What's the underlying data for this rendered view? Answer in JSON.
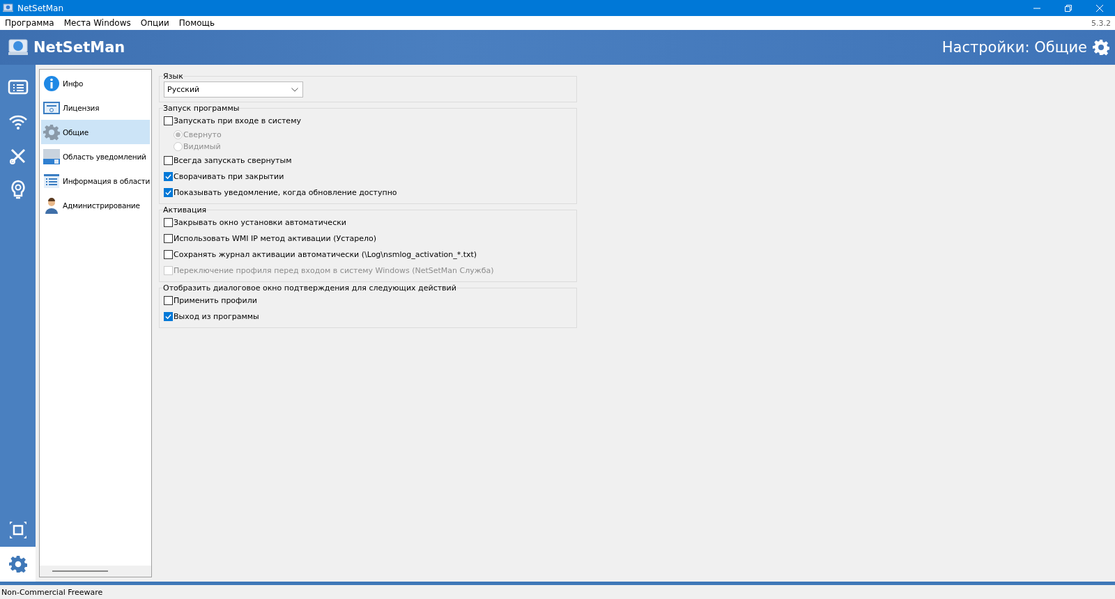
{
  "window": {
    "title": "NetSetMan"
  },
  "menu": [
    "Программа",
    "Места Windows",
    "Опции",
    "Помощь"
  ],
  "version": "5.3.2",
  "header": {
    "app_name": "NetSetMan",
    "page_title": "Настройки: Общие"
  },
  "rail": [
    {
      "kind": "profiles",
      "selected": false
    },
    {
      "kind": "wifi",
      "selected": false
    },
    {
      "kind": "tools",
      "selected": false
    },
    {
      "kind": "ideas",
      "selected": false
    },
    {
      "kind": "fullscreen",
      "selected": false
    },
    {
      "kind": "settings",
      "selected": true
    }
  ],
  "categories": [
    {
      "label": "Инфо",
      "kind": "info",
      "selected": false
    },
    {
      "label": "Лицензия",
      "kind": "license",
      "selected": false
    },
    {
      "label": "Общие",
      "kind": "general",
      "selected": true
    },
    {
      "label": "Область уведомлений",
      "kind": "tray",
      "selected": false
    },
    {
      "label": "Информация в области",
      "kind": "list",
      "selected": false
    },
    {
      "label": "Администрирование",
      "kind": "admin",
      "selected": false
    }
  ],
  "language": {
    "label": "Язык",
    "value": "Русский"
  },
  "groups": [
    {
      "title": "Запуск программы",
      "options": [
        {
          "kind": "checkbox",
          "label": "Запускать при входе в систему",
          "checked": false,
          "disabled": false
        },
        {
          "kind": "radio",
          "label": "Свернуто",
          "selected": true,
          "disabled": true
        },
        {
          "kind": "radio",
          "label": "Видимый",
          "selected": false,
          "disabled": true
        },
        {
          "kind": "checkbox",
          "label": "Всегда запускать свернутым",
          "checked": false,
          "disabled": false
        },
        {
          "kind": "checkbox",
          "label": "Сворачивать при закрытии",
          "checked": true,
          "disabled": false
        },
        {
          "kind": "checkbox",
          "label": "Показывать уведомление, когда обновление доступно",
          "checked": true,
          "disabled": false
        }
      ]
    },
    {
      "title": "Активация",
      "options": [
        {
          "kind": "checkbox",
          "label": "Закрывать окно установки автоматически",
          "checked": false,
          "disabled": false
        },
        {
          "kind": "checkbox",
          "label": "Использовать WMI IP метод активации (Устарело)",
          "checked": false,
          "disabled": false
        },
        {
          "kind": "checkbox",
          "label": "Сохранять журнал активации автоматически (\\Log\\nsmlog_activation_*.txt)",
          "checked": false,
          "disabled": false
        },
        {
          "kind": "checkbox",
          "label": "Переключение профиля перед входом в систему Windows (NetSetMan Служба)",
          "checked": false,
          "disabled": true
        }
      ]
    },
    {
      "title": "Отобразить диалоговое окно подтверждения для следующих действий",
      "options": [
        {
          "kind": "checkbox",
          "label": "Применить профили",
          "checked": false,
          "disabled": false
        },
        {
          "kind": "checkbox",
          "label": "Выход из программы",
          "checked": true,
          "disabled": false
        }
      ]
    }
  ],
  "status_bar": "Non-Commercial Freeware"
}
